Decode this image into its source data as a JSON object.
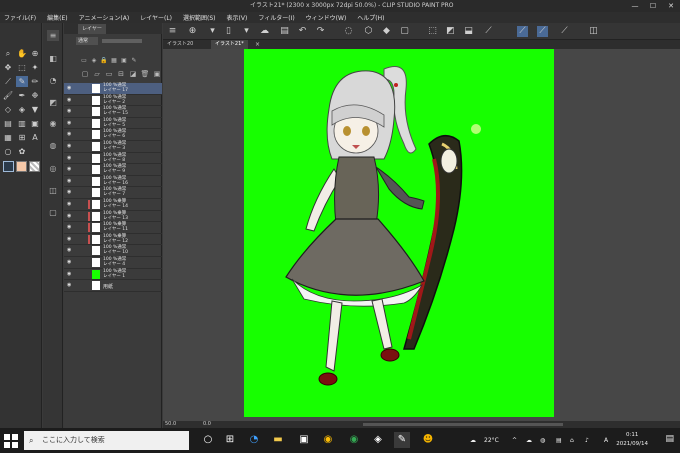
{
  "window": {
    "title": "イラスト21* (2300 x 3000px 72dpi 50.0%) - CLIP STUDIO PAINT PRO",
    "minimize": "—",
    "maximize": "☐",
    "close": "✕"
  },
  "menu": [
    "ファイル(F)",
    "編集(E)",
    "アニメーション(A)",
    "レイヤー(L)",
    "選択範囲(S)",
    "表示(V)",
    "フィルター(I)",
    "ウィンドウ(W)",
    "ヘルプ(H)"
  ],
  "layer_panel": {
    "tab_label": "レイヤー",
    "blend_mode": "通常",
    "layers": [
      {
        "pct": "100 %通常",
        "name": "レイヤー 17",
        "selected": true
      },
      {
        "pct": "100 %通常",
        "name": "レイヤー 2"
      },
      {
        "pct": "100 %通常",
        "name": "レイヤー 15"
      },
      {
        "pct": "100 %通常",
        "name": "レイヤー 5"
      },
      {
        "pct": "100 %通常",
        "name": "レイヤー 6"
      },
      {
        "pct": "100 %通常",
        "name": "レイヤー 3"
      },
      {
        "pct": "100 %通常",
        "name": "レイヤー 8"
      },
      {
        "pct": "100 %通常",
        "name": "レイヤー 9"
      },
      {
        "pct": "100 %通常",
        "name": "レイヤー 16"
      },
      {
        "pct": "100 %通常",
        "name": "レイヤー 7"
      },
      {
        "pct": "100 %乗算",
        "name": "レイヤー 14",
        "clip": true
      },
      {
        "pct": "100 %乗算",
        "name": "レイヤー 13",
        "clip": true
      },
      {
        "pct": "100 %乗算",
        "name": "レイヤー 11",
        "clip": true
      },
      {
        "pct": "100 %乗算",
        "name": "レイヤー 12",
        "clip": true
      },
      {
        "pct": "100 %通常",
        "name": "レイヤー 10"
      },
      {
        "pct": "100 %通常",
        "name": "レイヤー 4"
      },
      {
        "pct": "100 %通常",
        "name": "レイヤー 1",
        "green": true
      },
      {
        "single": "用紙"
      }
    ]
  },
  "tabs": [
    "イラスト20",
    "イラスト21*"
  ],
  "status": {
    "zoom": "50.0",
    "angle": "0.0"
  },
  "taskbar": {
    "search_placeholder": "ここに入力して検索",
    "weather": "22°C",
    "ime": "A",
    "time": "0:11",
    "date": "2021/09/14"
  },
  "colors": {
    "canvas": "#17ff00",
    "accent": "#4a6a96"
  }
}
